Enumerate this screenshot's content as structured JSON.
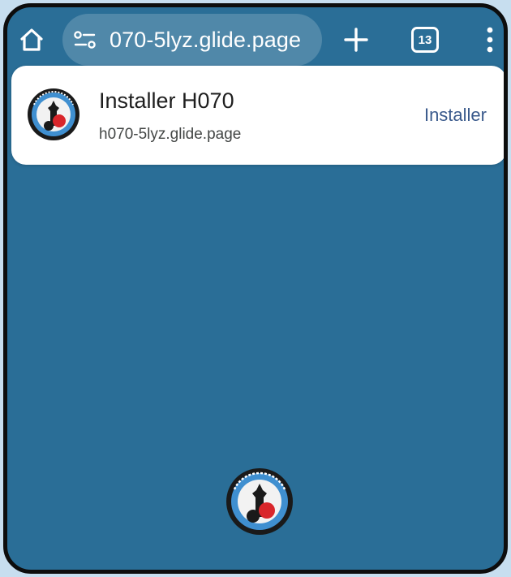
{
  "browser": {
    "url_display": "070-5lyz.glide.page",
    "tab_count": "13",
    "icons": {
      "home": "home-icon",
      "site_settings": "tune-icon",
      "new_tab": "plus-icon",
      "menu": "more-vert-icon"
    }
  },
  "install_prompt": {
    "title": "Installer H070",
    "url": "h070-5lyz.glide.page",
    "button_label": "Installer"
  },
  "colors": {
    "app_background": "#2a6e97",
    "card_background": "#ffffff",
    "accent_text": "#3a5a8c",
    "logo_red": "#d9262b",
    "logo_blue": "#3f8fd0"
  }
}
